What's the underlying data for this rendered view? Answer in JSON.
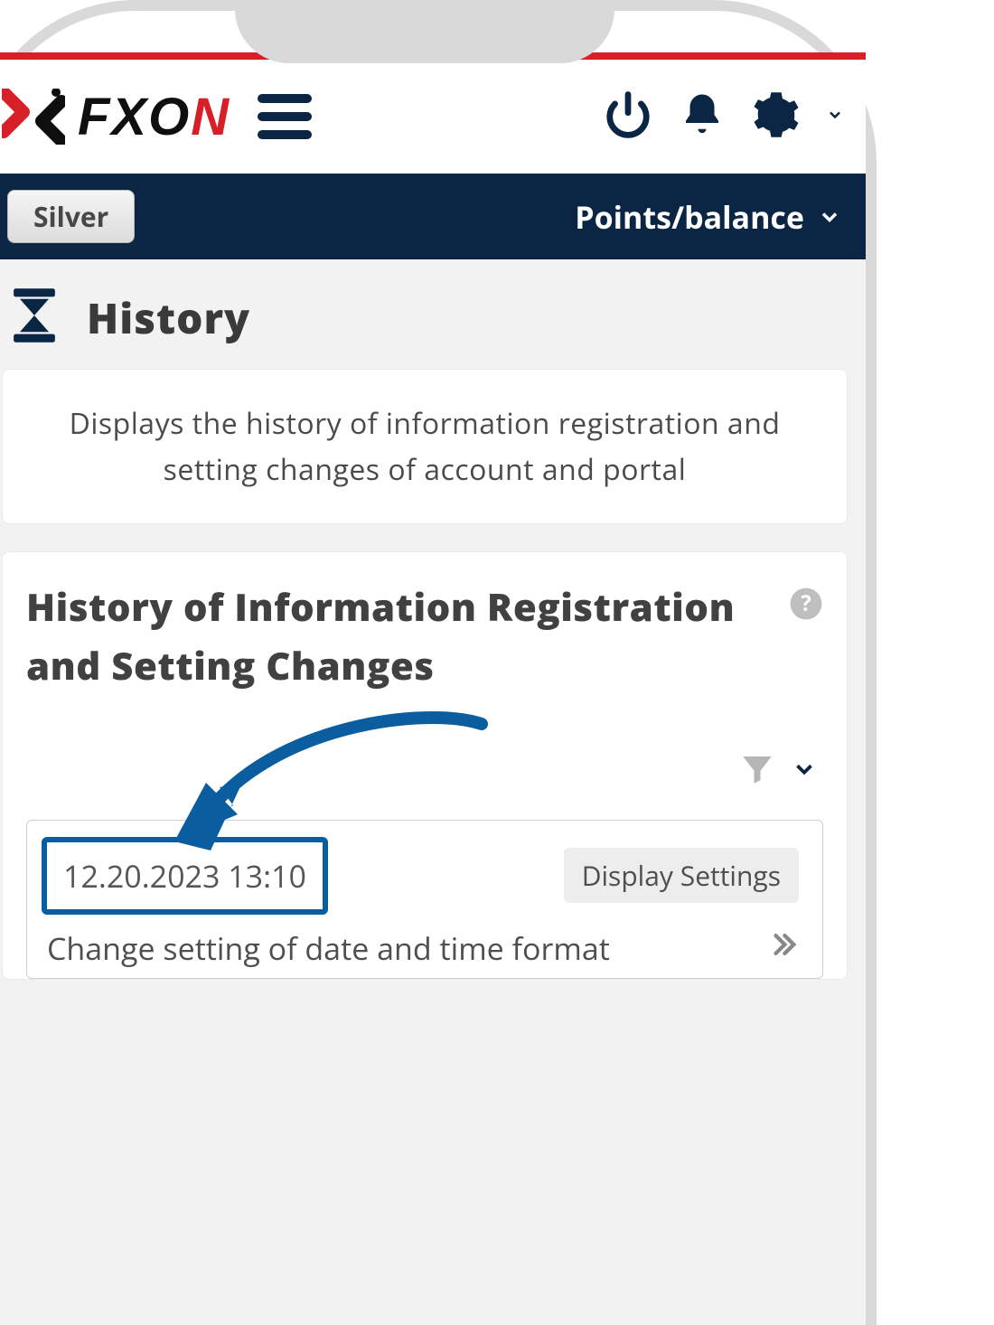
{
  "brand": {
    "name_prefix": "FXO",
    "name_accent": "N"
  },
  "subheader": {
    "tier": "Silver",
    "points_label": "Points/balance"
  },
  "page": {
    "title": "History",
    "description": "Displays the history of information registration and setting changes of account and portal"
  },
  "section": {
    "title": "History of Information Registration and Setting Changes"
  },
  "history": {
    "items": [
      {
        "timestamp": "12.20.2023 13:10",
        "category": "Display Settings",
        "action": "Change setting of date and time format"
      }
    ]
  }
}
